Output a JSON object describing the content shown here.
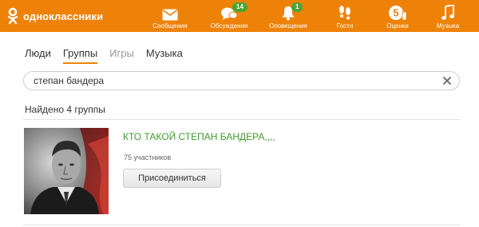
{
  "header": {
    "logo_text": "одноклассники",
    "nav": [
      {
        "label": "Сообщения",
        "icon": "envelope-icon"
      },
      {
        "label": "Обсуждения",
        "icon": "speech-bubbles-icon",
        "badge": "14"
      },
      {
        "label": "Оповещения",
        "icon": "bell-icon",
        "badge": "1"
      },
      {
        "label": "Гости",
        "icon": "footprints-icon"
      },
      {
        "label": "Оценки",
        "icon": "rating-icon"
      },
      {
        "label": "Музыка",
        "icon": "music-note-icon"
      }
    ]
  },
  "tabs": [
    {
      "label": "Люди"
    },
    {
      "label": "Группы",
      "active": true
    },
    {
      "label": "Игры"
    },
    {
      "label": "Музыка"
    }
  ],
  "search": {
    "value": "степан бандера"
  },
  "results_count": "Найдено 4 группы",
  "results": [
    {
      "title": "КТО ТАКОЙ СТЕПАН БАНДЕРА,,,,",
      "members": "75 участников",
      "join_label": "Присоединиться"
    }
  ],
  "colors": {
    "brand": "#ee8208",
    "link_green": "#3f9d2a",
    "badge_green": "#4aa631"
  }
}
